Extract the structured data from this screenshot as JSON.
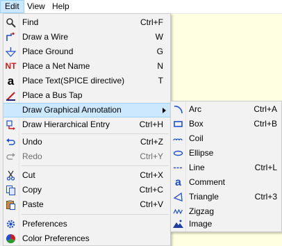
{
  "menubar": {
    "items": [
      "Edit",
      "View",
      "Help"
    ]
  },
  "edit_menu": {
    "items": [
      {
        "label": "Find",
        "shortcut": "Ctrl+F",
        "icon": "magnifier-icon"
      },
      {
        "label": "Draw a Wire",
        "shortcut": "W",
        "icon": "wire-icon"
      },
      {
        "label": "Place Ground",
        "shortcut": "G",
        "icon": "ground-icon"
      },
      {
        "label": "Place a Net Name",
        "shortcut": "N",
        "icon": "net-name-icon",
        "icon_text": "NT"
      },
      {
        "label": "Place Text(SPICE directive)",
        "shortcut": "T",
        "icon": "text-icon",
        "icon_text": "a"
      },
      {
        "label": "Place a Bus Tap",
        "shortcut": "",
        "icon": "bus-tap-icon"
      },
      {
        "label": "Draw Graphical Annotation",
        "shortcut": "",
        "icon": "",
        "submenu": true
      },
      {
        "label": "Draw Hierarchical Entry",
        "shortcut": "Ctrl+H",
        "icon": "hier-entry-icon"
      },
      {
        "label": "Undo",
        "shortcut": "Ctrl+Z",
        "icon": "undo-icon"
      },
      {
        "label": "Redo",
        "shortcut": "Ctrl+Y",
        "icon": "redo-icon",
        "disabled": true
      },
      {
        "label": "Cut",
        "shortcut": "Ctrl+X",
        "icon": "scissors-icon"
      },
      {
        "label": "Copy",
        "shortcut": "Ctrl+C",
        "icon": "copy-icon"
      },
      {
        "label": "Paste",
        "shortcut": "Ctrl+V",
        "icon": "paste-icon"
      },
      {
        "label": "Preferences",
        "shortcut": "",
        "icon": "gear-icon"
      },
      {
        "label": "Color Preferences",
        "shortcut": "",
        "icon": "color-wheel-icon"
      }
    ]
  },
  "annotation_submenu": {
    "items": [
      {
        "label": "Arc",
        "shortcut": "Ctrl+A",
        "icon": "arc-icon"
      },
      {
        "label": "Box",
        "shortcut": "Ctrl+B",
        "icon": "box-icon"
      },
      {
        "label": "Coil",
        "shortcut": "",
        "icon": "coil-icon"
      },
      {
        "label": "Ellipse",
        "shortcut": "",
        "icon": "ellipse-icon"
      },
      {
        "label": "Line",
        "shortcut": "Ctrl+L",
        "icon": "line-icon"
      },
      {
        "label": "Comment",
        "shortcut": "",
        "icon": "comment-icon",
        "icon_text": "a"
      },
      {
        "label": "Triangle",
        "shortcut": "Ctrl+3",
        "icon": "triangle-icon"
      },
      {
        "label": "Zigzag",
        "shortcut": "",
        "icon": "zigzag-icon"
      },
      {
        "label": "Image",
        "shortcut": "",
        "icon": "image-icon"
      }
    ]
  },
  "colors": {
    "highlight": "#cce8ff",
    "menu_bg": "#f2f2f2",
    "canvas_bg": "#ffffe1",
    "icon_blue": "#1f4fd1",
    "icon_red": "#d11a1a"
  }
}
